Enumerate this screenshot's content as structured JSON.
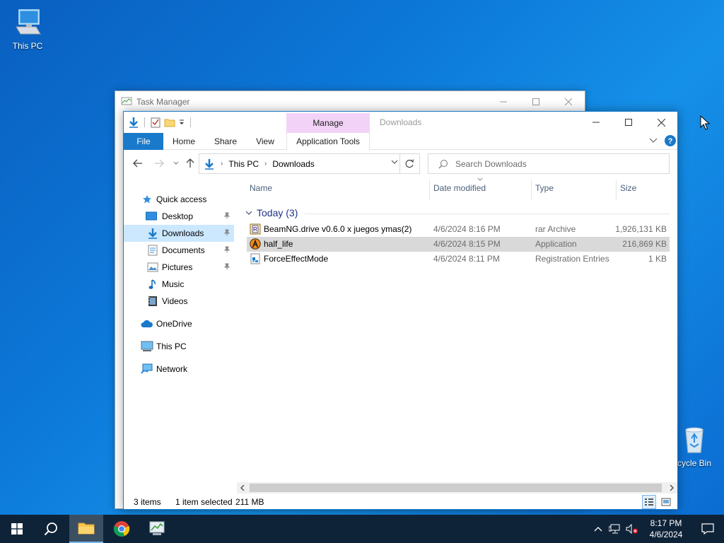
{
  "desktop": {
    "icons": [
      {
        "label": "This PC",
        "icon": "this-pc-icon"
      },
      {
        "label": "cycle Bin",
        "icon": "recycle-bin-icon"
      }
    ]
  },
  "task_manager": {
    "title": "Task Manager"
  },
  "explorer": {
    "window_title": "Downloads",
    "contextual_group": "Manage",
    "ribbon_tabs": [
      "File",
      "Home",
      "Share",
      "View",
      "Application Tools"
    ],
    "address": {
      "crumbs": [
        "This PC",
        "Downloads"
      ]
    },
    "search": {
      "placeholder": "Search Downloads"
    },
    "nav_pane": [
      {
        "label": "Quick access",
        "icon": "star-icon"
      },
      {
        "label": "Desktop",
        "icon": "desktop-folder-icon",
        "pinned": true
      },
      {
        "label": "Downloads",
        "icon": "downloads-folder-icon",
        "pinned": true,
        "selected": true
      },
      {
        "label": "Documents",
        "icon": "documents-folder-icon",
        "pinned": true
      },
      {
        "label": "Pictures",
        "icon": "pictures-folder-icon",
        "pinned": true
      },
      {
        "label": "Music",
        "icon": "music-folder-icon"
      },
      {
        "label": "Videos",
        "icon": "videos-folder-icon"
      },
      {
        "label": "OneDrive",
        "icon": "onedrive-icon"
      },
      {
        "label": "This PC",
        "icon": "this-pc-icon"
      },
      {
        "label": "Network",
        "icon": "network-icon"
      }
    ],
    "columns": [
      "Name",
      "Date modified",
      "Type",
      "Size"
    ],
    "group_label": "Today (3)",
    "files": [
      {
        "name": "BeamNG.drive v0.6.0 x juegos ymas(2)",
        "date": "4/6/2024 8:16 PM",
        "type": "rar Archive",
        "size": "1,926,131 KB",
        "icon": "rar-archive-icon",
        "selected": false
      },
      {
        "name": "half_life",
        "date": "4/6/2024 8:15 PM",
        "type": "Application",
        "size": "216,869 KB",
        "icon": "half-life-app-icon",
        "selected": true
      },
      {
        "name": "ForceEffectMode",
        "date": "4/6/2024 8:11 PM",
        "type": "Registration Entries",
        "size": "1 KB",
        "icon": "registry-file-icon",
        "selected": false
      }
    ],
    "status": {
      "items": "3 items",
      "selection": "1 item selected",
      "size": "211 MB"
    }
  },
  "taskbar": {
    "pinned": [
      "start-icon",
      "search-icon",
      "file-explorer-icon",
      "chrome-icon",
      "task-manager-icon"
    ],
    "clock": {
      "time": "8:17 PM",
      "date": "4/6/2024"
    }
  },
  "colors": {
    "accent": "#1979ca",
    "manage_tab": "#f2d3f7",
    "selection": "#cce8ff",
    "taskbar": "#0f2338"
  }
}
